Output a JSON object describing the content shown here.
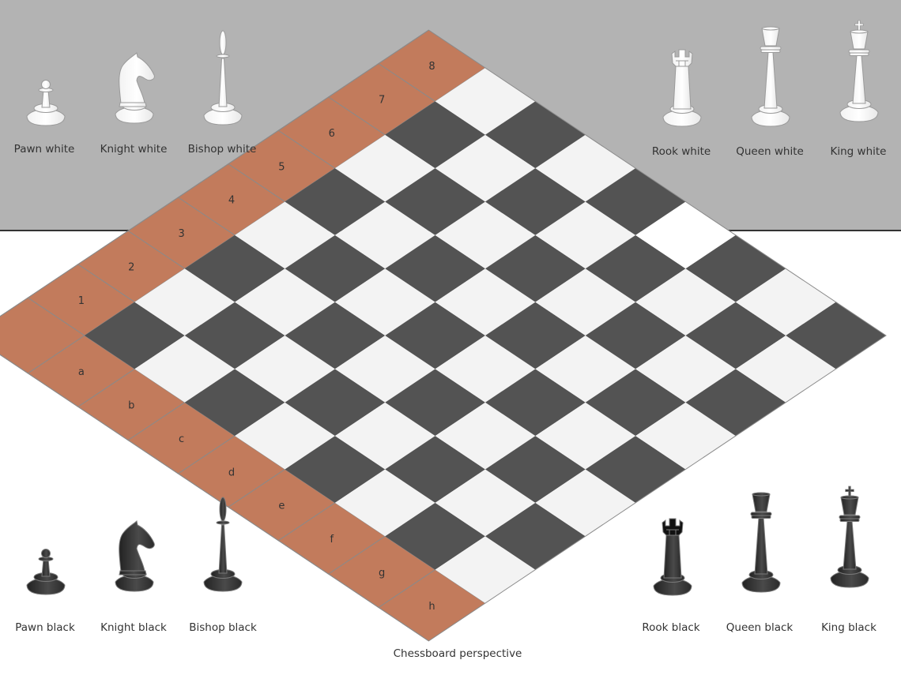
{
  "title": "Chessboard perspective",
  "colors": {
    "top_band": "#b3b3b3",
    "border": "#c27b5c",
    "dark_square": "#535353",
    "light_square": "#f3f3f3",
    "highlight_square": "#ffffff",
    "white_piece": "#ffffff",
    "black_piece": "#3a3a3a"
  },
  "board": {
    "files": [
      "a",
      "b",
      "c",
      "d",
      "e",
      "f",
      "g",
      "h"
    ],
    "ranks": [
      "1",
      "2",
      "3",
      "4",
      "5",
      "6",
      "7",
      "8"
    ],
    "highlighted_square": "e8"
  },
  "pieces": {
    "white": [
      {
        "type": "pawn",
        "label": "Pawn white"
      },
      {
        "type": "knight",
        "label": "Knight white"
      },
      {
        "type": "bishop",
        "label": "Bishop white"
      },
      {
        "type": "rook",
        "label": "Rook white"
      },
      {
        "type": "queen",
        "label": "Queen white"
      },
      {
        "type": "king",
        "label": "King white"
      }
    ],
    "black": [
      {
        "type": "pawn",
        "label": "Pawn black"
      },
      {
        "type": "knight",
        "label": "Knight black"
      },
      {
        "type": "bishop",
        "label": "Bishop black"
      },
      {
        "type": "rook",
        "label": "Rook black"
      },
      {
        "type": "queen",
        "label": "Queen black"
      },
      {
        "type": "king",
        "label": "King black"
      }
    ]
  }
}
